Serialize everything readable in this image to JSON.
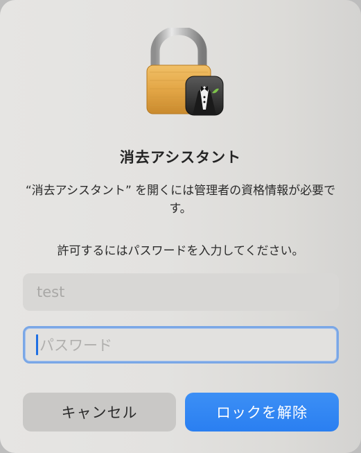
{
  "dialog": {
    "app_icon": "lock-with-butler-icon",
    "title": "消去アシスタント",
    "message": "“消去アシスタント” を開くには管理者の資格情報が必要です。",
    "prompt": "許可するにはパスワードを入力してください。"
  },
  "fields": {
    "username": {
      "value": "test"
    },
    "password": {
      "value": "",
      "placeholder": "パスワード"
    }
  },
  "buttons": {
    "cancel_label": "キャンセル",
    "unlock_label": "ロックを解除"
  },
  "colors": {
    "accent": "#2a7ff1",
    "focus_ring": "#7aa7e6"
  }
}
